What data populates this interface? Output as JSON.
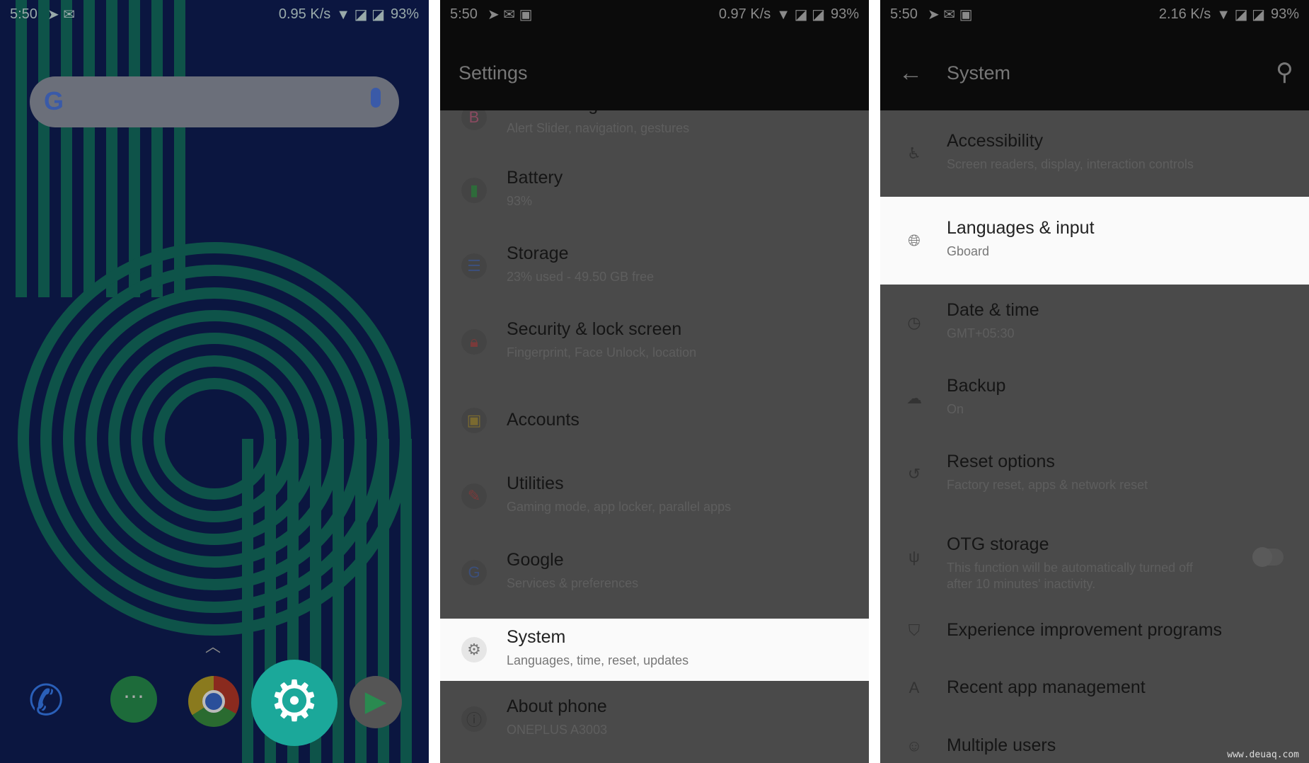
{
  "home": {
    "status": {
      "time": "5:50",
      "speed": "0.95 K/s",
      "battery": "93%"
    },
    "search_icon": "google-logo",
    "mic_icon": "mic-icon",
    "dock": [
      "phone-icon",
      "messages-icon",
      "chrome-icon",
      "settings-icon",
      "play-store-icon"
    ]
  },
  "settings": {
    "status": {
      "time": "5:50",
      "speed": "0.97 K/s",
      "battery": "93%"
    },
    "title": "Settings",
    "items": [
      {
        "title": "Buttons & gestures",
        "subtitle": "Alert Slider, navigation, gestures",
        "icon": "B",
        "color": "#8a4a60"
      },
      {
        "title": "Battery",
        "subtitle": "93%",
        "icon": "▮",
        "color": "#2e6b3a"
      },
      {
        "title": "Storage",
        "subtitle": "23% used - 49.50 GB free",
        "icon": "☰",
        "color": "#3c4f7a"
      },
      {
        "title": "Security & lock screen",
        "subtitle": "Fingerprint, Face Unlock, location",
        "icon": "🔒︎",
        "color": "#7a3a3a"
      },
      {
        "title": "Accounts",
        "subtitle": "",
        "icon": "▣",
        "color": "#7a6a30"
      },
      {
        "title": "Utilities",
        "subtitle": "Gaming mode, app locker, parallel apps",
        "icon": "✎",
        "color": "#7a3a3a"
      },
      {
        "title": "Google",
        "subtitle": "Services & preferences",
        "icon": "G",
        "color": "#3c4f7a"
      },
      {
        "title": "System",
        "subtitle": "Languages, time, reset, updates",
        "icon": "⚙",
        "color": "#777777"
      },
      {
        "title": "About phone",
        "subtitle": "ONEPLUS A3003",
        "icon": "ⓘ",
        "color": "#333333"
      }
    ]
  },
  "system": {
    "status": {
      "time": "5:50",
      "speed": "2.16 K/s",
      "battery": "93%"
    },
    "title": "System",
    "back_icon": "arrow-left-icon",
    "search_icon": "search-icon",
    "items": [
      {
        "title": "Accessibility",
        "subtitle": "Screen readers, display, interaction controls",
        "icon": "♿︎"
      },
      {
        "title": "Languages & input",
        "subtitle": "Gboard",
        "icon": "🌐︎"
      },
      {
        "title": "Date & time",
        "subtitle": "GMT+05:30",
        "icon": "◷"
      },
      {
        "title": "Backup",
        "subtitle": "On",
        "icon": "☁︎"
      },
      {
        "title": "Reset options",
        "subtitle": "Factory reset, apps & network reset",
        "icon": "↺"
      },
      {
        "title": "OTG storage",
        "subtitle": "This function will be automatically turned off after 10 minutes' inactivity.",
        "icon": "ψ",
        "toggle": false
      },
      {
        "title": "Experience improvement programs",
        "subtitle": "",
        "icon": "⛉"
      },
      {
        "title": "Recent app management",
        "subtitle": "",
        "icon": "A"
      },
      {
        "title": "Multiple users",
        "subtitle": "",
        "icon": "☺︎"
      }
    ]
  },
  "watermark": "www.deuaq.com"
}
